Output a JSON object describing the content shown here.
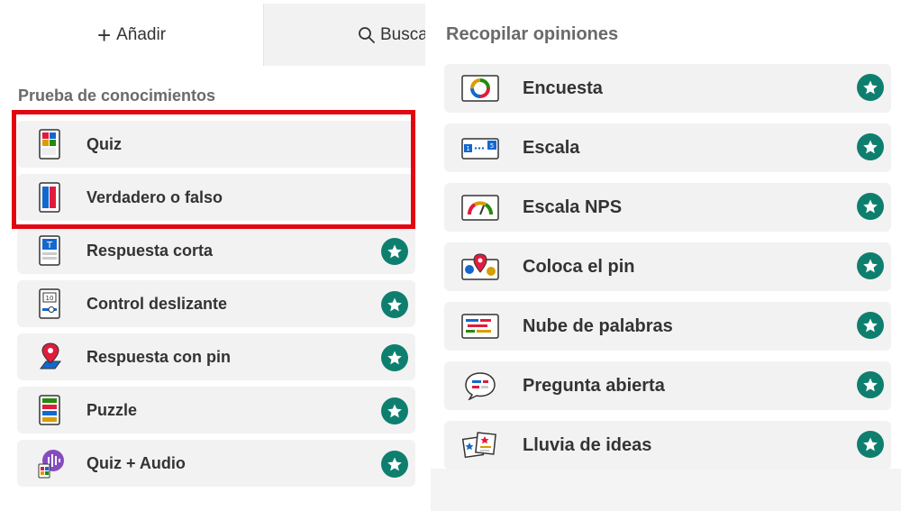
{
  "tabs": {
    "add_label": "Añadir",
    "search_label": "Busca"
  },
  "left": {
    "title": "Prueba de conocimientos",
    "items": [
      {
        "label": "Quiz",
        "icon": "quiz-icon",
        "premium": false
      },
      {
        "label": "Verdadero o falso",
        "icon": "true-false-icon",
        "premium": false
      },
      {
        "label": "Respuesta corta",
        "icon": "short-answer-icon",
        "premium": true
      },
      {
        "label": "Control deslizante",
        "icon": "slider-icon",
        "premium": true
      },
      {
        "label": "Respuesta con pin",
        "icon": "pin-answer-icon",
        "premium": true
      },
      {
        "label": "Puzzle",
        "icon": "puzzle-icon",
        "premium": true
      },
      {
        "label": "Quiz + Audio",
        "icon": "quiz-audio-icon",
        "premium": true
      }
    ]
  },
  "right": {
    "title": "Recopilar opiniones",
    "items": [
      {
        "label": "Encuesta",
        "icon": "poll-icon",
        "premium": true
      },
      {
        "label": "Escala",
        "icon": "scale-icon",
        "premium": true
      },
      {
        "label": "Escala NPS",
        "icon": "nps-scale-icon",
        "premium": true
      },
      {
        "label": "Coloca el pin",
        "icon": "drop-pin-icon",
        "premium": true
      },
      {
        "label": "Nube de palabras",
        "icon": "word-cloud-icon",
        "premium": true
      },
      {
        "label": "Pregunta abierta",
        "icon": "open-ended-icon",
        "premium": true
      },
      {
        "label": "Lluvia de ideas",
        "icon": "brainstorm-icon",
        "premium": true
      }
    ]
  },
  "colors": {
    "highlight": "#e30611",
    "star_badge": "#0e7f6e",
    "item_bg": "#f2f2f2"
  }
}
